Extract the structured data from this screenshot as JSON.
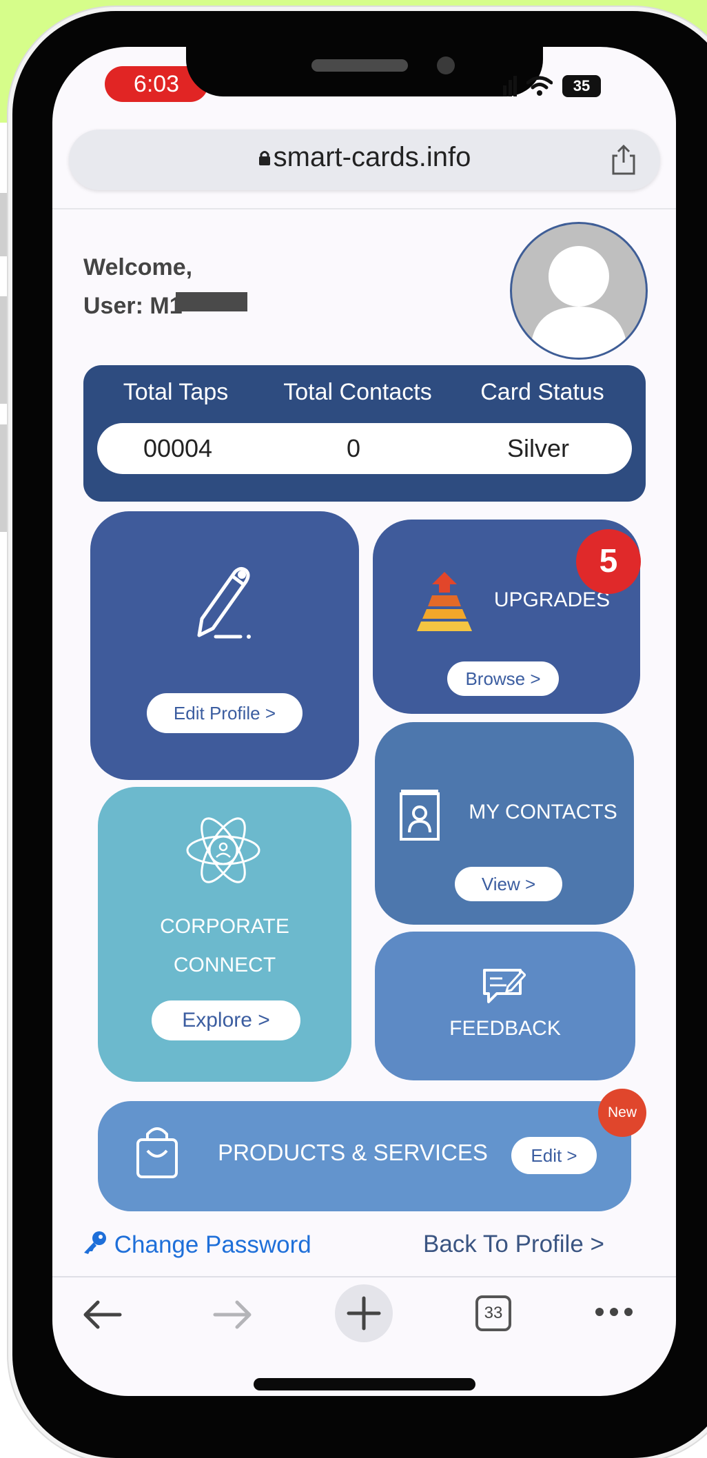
{
  "status_bar": {
    "time": "6:03",
    "battery": "35"
  },
  "browser": {
    "url": "smart-cards.info",
    "tab_count": "33"
  },
  "welcome": {
    "line1": "Welcome,",
    "line2": "User: M1"
  },
  "stats": {
    "headers": [
      "Total Taps",
      "Total Contacts",
      "Card Status"
    ],
    "values": [
      "00004",
      "0",
      "Silver"
    ]
  },
  "tiles": {
    "edit_profile": {
      "button": "Edit Profile >"
    },
    "upgrades": {
      "title": "UPGRADES",
      "button": "Browse >",
      "badge": "5"
    },
    "contacts": {
      "title": "MY CONTACTS",
      "button": "View >"
    },
    "corporate": {
      "title_line1": "CORPORATE",
      "title_line2": "CONNECT",
      "button": "Explore >"
    },
    "feedback": {
      "title": "FEEDBACK"
    },
    "products": {
      "title": "PRODUCTS & SERVICES",
      "button": "Edit >",
      "badge": "New"
    }
  },
  "links": {
    "change_password": "Change Password",
    "back_to_profile": "Back To Profile >"
  },
  "colors": {
    "accent_red": "#e12524",
    "stats_bg": "#2e4c80",
    "tile_dark": "#3f5b9b",
    "tile_mid": "#4d77ad",
    "tile_light": "#5d8ac5",
    "tile_teal": "#6cb9cd",
    "link_blue": "#1e6fd9"
  }
}
